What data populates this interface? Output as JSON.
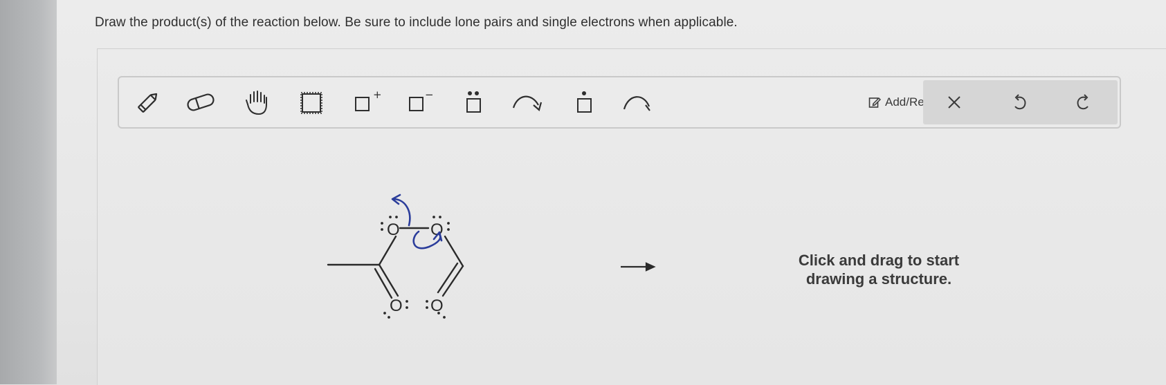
{
  "question": {
    "text": "Draw the product(s) of the reaction below. Be sure to include lone pairs and single electrons when applicable."
  },
  "toolbar": {
    "tools": [
      {
        "name": "pencil-icon"
      },
      {
        "name": "eraser-icon"
      },
      {
        "name": "hand-icon"
      },
      {
        "name": "select-box-icon"
      },
      {
        "name": "add-positive-charge-icon",
        "superscript": "+"
      },
      {
        "name": "add-negative-charge-icon",
        "superscript": "−"
      },
      {
        "name": "lone-pair-icon"
      },
      {
        "name": "curved-arrow-icon"
      },
      {
        "name": "single-electron-icon"
      },
      {
        "name": "half-arrow-icon"
      }
    ],
    "step_label": "Add/Remove step",
    "clear_icon": "close-icon",
    "undo_icon": "undo-icon",
    "redo_icon": "redo-icon"
  },
  "molecule": {
    "atoms": [
      "O",
      "O",
      "O",
      "O"
    ],
    "arrow_color": "#2b3d9b"
  },
  "canvas": {
    "hint_line1": "Click and drag to start",
    "hint_line2": "drawing a structure."
  }
}
